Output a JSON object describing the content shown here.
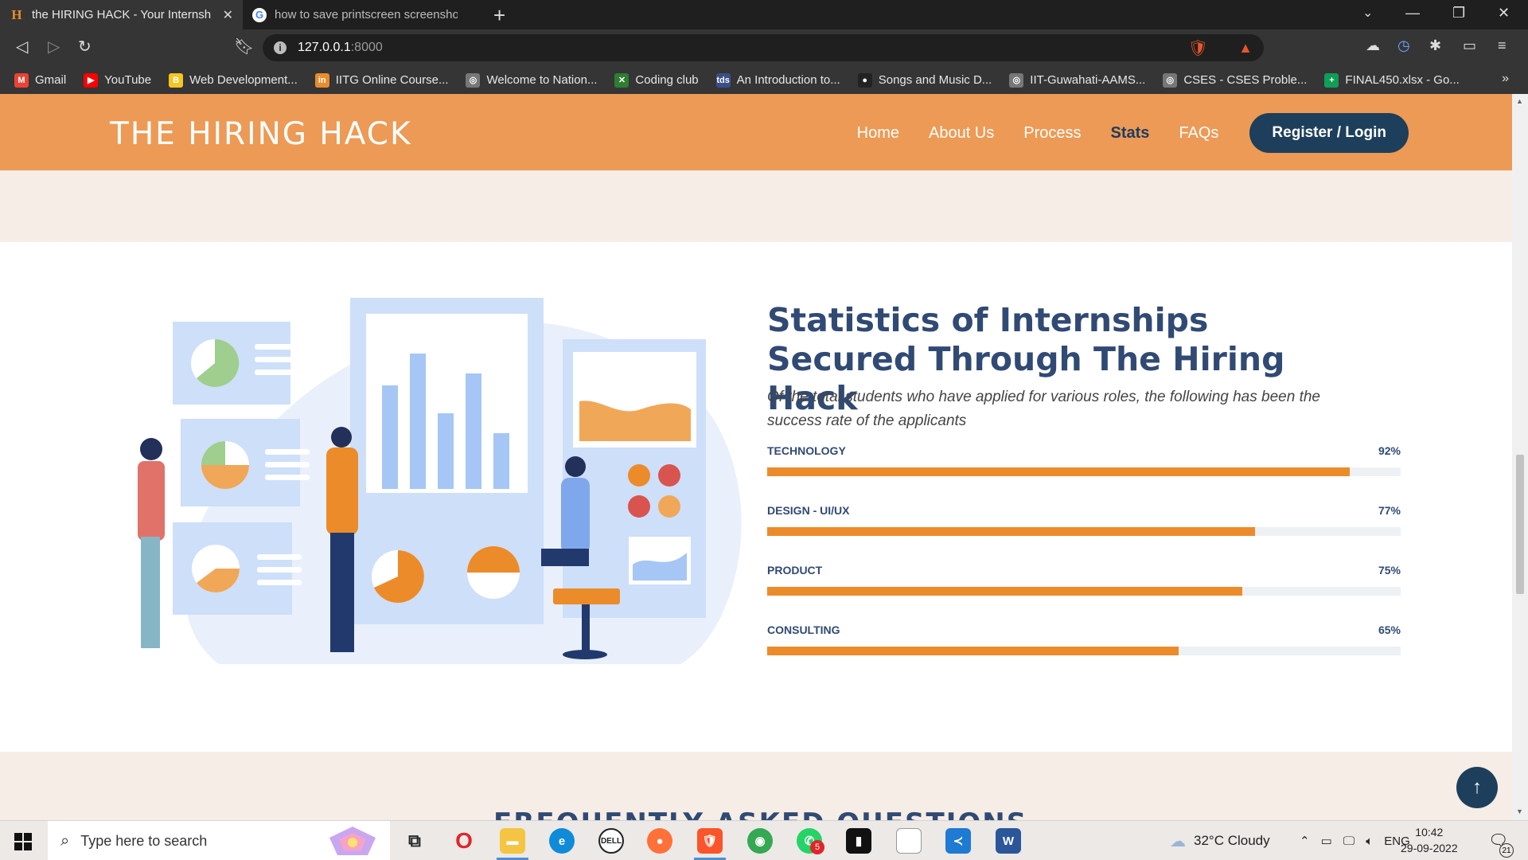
{
  "browser": {
    "tabs": [
      {
        "title": "the HIRING HACK - Your Internsh",
        "active": true
      },
      {
        "title": "how to save printscreen screenshots in",
        "active": false
      }
    ],
    "url_host": "127.0.0.1",
    "url_port": ":8000",
    "bookmarks": [
      {
        "label": "Gmail",
        "icon": "gmail-icon",
        "color": "#ea4335",
        "glyph": "M"
      },
      {
        "label": "YouTube",
        "icon": "youtube-icon",
        "color": "#ff0000",
        "glyph": "▶"
      },
      {
        "label": "Web Development...",
        "icon": "globe-icon",
        "color": "#f3c623",
        "glyph": "B"
      },
      {
        "label": "IITG Online Course...",
        "icon": "iitg-icon",
        "color": "#e88c2c",
        "glyph": "in"
      },
      {
        "label": "Welcome to Nation...",
        "icon": "globe-icon",
        "color": "#777777",
        "glyph": "◎"
      },
      {
        "label": "Coding club",
        "icon": "coding-club-icon",
        "color": "#2e7d32",
        "glyph": "✕"
      },
      {
        "label": "An Introduction to...",
        "icon": "tds-icon",
        "color": "#3a4f8a",
        "glyph": "tds"
      },
      {
        "label": "Songs and Music D...",
        "icon": "github-icon",
        "color": "#222222",
        "glyph": "●"
      },
      {
        "label": "IIT-Guwahati-AAMS...",
        "icon": "globe-icon",
        "color": "#777777",
        "glyph": "◎"
      },
      {
        "label": "CSES - CSES Proble...",
        "icon": "globe-icon",
        "color": "#777777",
        "glyph": "◎"
      },
      {
        "label": "FINAL450.xlsx - Go...",
        "icon": "sheets-icon",
        "color": "#0f9d58",
        "glyph": "+"
      }
    ]
  },
  "site": {
    "logo": "THE HIRING HACK",
    "menu": [
      {
        "label": "Home",
        "active": false
      },
      {
        "label": "About Us",
        "active": false
      },
      {
        "label": "Process",
        "active": false
      },
      {
        "label": "Stats",
        "active": true
      },
      {
        "label": "FAQs",
        "active": false
      }
    ],
    "register_label": "Register / Login"
  },
  "stats": {
    "title": "Statistics of Internships Secured Through The Hiring Hack",
    "description": "Of the total students who have applied for various roles, the following has been the success rate of the applicants",
    "skills": [
      {
        "label": "TECHNOLOGY",
        "percent_label": "92%",
        "value": 92
      },
      {
        "label": "DESIGN - UI/UX",
        "percent_label": "77%",
        "value": 77
      },
      {
        "label": "PRODUCT",
        "percent_label": "75%",
        "value": 75
      },
      {
        "label": "CONSULTING",
        "percent_label": "65%",
        "value": 65
      }
    ]
  },
  "next_section_title": "FREQUENTLY ASKED QUESTIONS",
  "taskbar": {
    "search_placeholder": "Type here to search",
    "weather": "32°C  Cloudy",
    "language": "ENG",
    "time": "10:42",
    "date": "29-09-2022",
    "notifications": "21",
    "whatsapp_badge": "5"
  },
  "colors": {
    "header": "#ec9a55",
    "accent": "#ec8b2a",
    "navy": "#1d3f5b",
    "title": "#304a74"
  }
}
